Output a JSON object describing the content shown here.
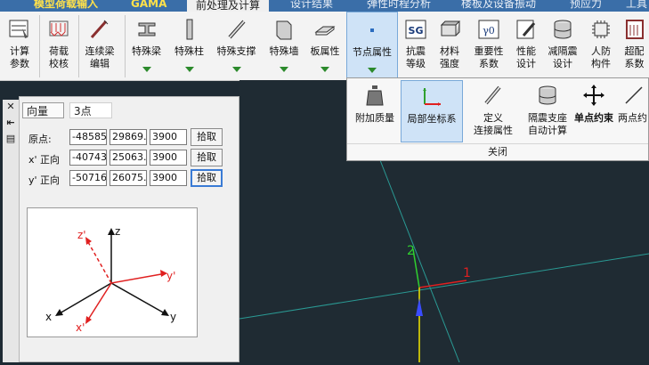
{
  "tabs": [
    {
      "label": "模型荷载输入",
      "style": "yellow"
    },
    {
      "label": "GAMA",
      "style": "yellow"
    },
    {
      "label": "前处理及计算",
      "style": "active"
    },
    {
      "label": "设计结果",
      "style": "normal"
    },
    {
      "label": "弹性时程分析",
      "style": "normal"
    },
    {
      "label": "楼板及设备振动",
      "style": "normal"
    },
    {
      "label": "预应力",
      "style": "normal"
    },
    {
      "label": "工具",
      "style": "normal"
    }
  ],
  "ribbon": {
    "calc_params": "计算\n参数",
    "load_check": "荷载\n校核",
    "cont_beam": "连续梁\n编辑",
    "special_beam": "特殊梁",
    "special_col": "特殊柱",
    "special_brace": "特殊支撑",
    "special_wall": "特殊墙",
    "slab_prop": "板属性",
    "node_prop": "节点属性",
    "seismic_grade": "抗震\n等级",
    "mat_strength": "材料\n强度",
    "importance": "重要性\n系数",
    "performance": "性能\n设计",
    "isolation": "减隔震\n设计",
    "civil_def": "人防\n构件",
    "overmatch": "超配\n系数"
  },
  "dropdown": {
    "add_mass": "附加质量",
    "local_coord": "局部坐标系",
    "custom_bearing": "定义\n连接属性",
    "isolation_calc": "隔震支座\n自动计算",
    "single_restraint": "单点约束",
    "two_point": "两点约",
    "close": "关闭"
  },
  "panel": {
    "tab_direction": "向量",
    "tab_3pt": "3点",
    "origin_label": "原点:",
    "x_label": "x' 正向",
    "y_label": "y' 正向",
    "origin": [
      "-48585",
      "29869.",
      "3900"
    ],
    "xdir": [
      "-40743",
      "25063.",
      "3900"
    ],
    "ydir": [
      "-50716",
      "26075.",
      "3900"
    ],
    "pick": "拾取"
  },
  "diagram": {
    "z": "z",
    "x": "x",
    "y": "y",
    "zp": "z'",
    "xp": "x'",
    "yp": "y'"
  },
  "viewport": {
    "axis1": "1",
    "axis2": "2"
  },
  "colors": {
    "accent_red": "#e02020",
    "axis_green": "#2fd02f",
    "axis_yellow": "#f2e600",
    "axis_blue": "#3a4cff",
    "grid_teal": "#2a9a94"
  }
}
